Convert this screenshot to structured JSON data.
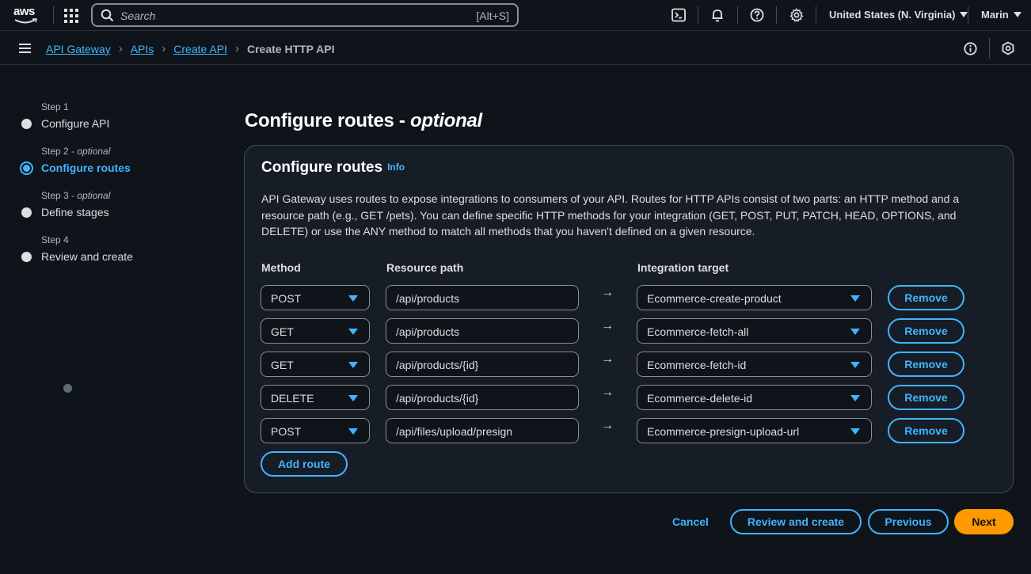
{
  "topbar": {
    "logo_text": "aws",
    "search_placeholder": "Search",
    "search_shortcut": "[Alt+S]",
    "region": "United States (N. Virginia)",
    "user": "Marin",
    "icons": [
      "apps-grid-icon",
      "search-icon",
      "cloudshell-icon",
      "bell-icon",
      "help-icon",
      "gear-icon"
    ]
  },
  "breadcrumb": {
    "items": [
      "API Gateway",
      "APIs",
      "Create API"
    ],
    "current": "Create HTTP API"
  },
  "steps": [
    {
      "number": "Step 1",
      "optional": "",
      "label": "Configure API"
    },
    {
      "number": "Step 2 - ",
      "optional": "optional",
      "label": "Configure routes"
    },
    {
      "number": "Step 3 - ",
      "optional": "optional",
      "label": "Define stages"
    },
    {
      "number": "Step 4",
      "optional": "",
      "label": "Review and create"
    }
  ],
  "page": {
    "title": "Configure routes - ",
    "title_optional": "optional"
  },
  "panel": {
    "heading": "Configure routes",
    "info": "Info",
    "description": "API Gateway uses routes to expose integrations to consumers of your API. Routes for HTTP APIs consist of two parts: an HTTP method and a resource path (e.g., GET /pets). You can define specific HTTP methods for your integration (GET, POST, PUT, PATCH, HEAD, OPTIONS, and DELETE) or use the ANY method to match all methods that you haven't defined on a given resource.",
    "col_method": "Method",
    "col_path": "Resource path",
    "col_target": "Integration target",
    "arrow": "→",
    "remove_label": "Remove",
    "add_route": "Add route"
  },
  "routes": [
    {
      "method": "POST",
      "path": "/api/products",
      "target": "Ecommerce-create-product"
    },
    {
      "method": "GET",
      "path": "/api/products",
      "target": "Ecommerce-fetch-all"
    },
    {
      "method": "GET",
      "path": "/api/products/{id}",
      "target": "Ecommerce-fetch-id"
    },
    {
      "method": "DELETE",
      "path": "/api/products/{id}",
      "target": "Ecommerce-delete-id"
    },
    {
      "method": "POST",
      "path": "/api/files/upload/presign",
      "target": "Ecommerce-presign-upload-url"
    }
  ],
  "footer": {
    "cancel": "Cancel",
    "review": "Review and create",
    "previous": "Previous",
    "next": "Next"
  },
  "colors": {
    "accent": "#42b4ff",
    "primary": "#ff9900",
    "background": "#0f141a",
    "panel": "#161d26"
  }
}
